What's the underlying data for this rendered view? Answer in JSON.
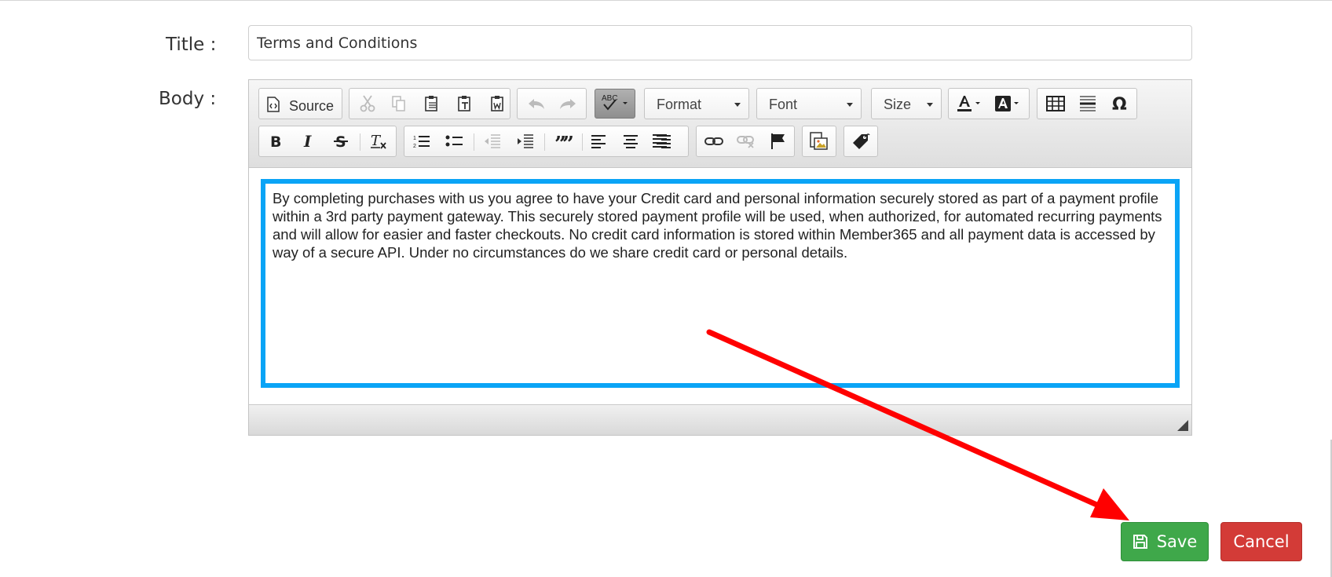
{
  "form": {
    "title_label": "Title :",
    "title_value": "Terms and Conditions",
    "body_label": "Body :"
  },
  "toolbar": {
    "source_label": "Source",
    "format_label": "Format",
    "font_label": "Font",
    "size_label": "Size"
  },
  "editor": {
    "content": "By completing purchases with us you agree to have your Credit card and personal information securely stored as part of a payment profile within a 3rd party payment gateway. This securely stored payment profile will be used, when authorized, for automated recurring payments and will allow for easier and faster checkouts. No credit card information is stored within Member365 and all payment data is accessed by way of a secure API. Under no circumstances do we share credit card or personal details."
  },
  "actions": {
    "save_label": "Save",
    "cancel_label": "Cancel"
  },
  "colors": {
    "highlight_border": "#0aa4f6",
    "annotation_arrow": "#ff0000",
    "save_button": "#3fa84a",
    "cancel_button": "#d33b37"
  },
  "icons": [
    "source-icon",
    "cut-icon",
    "copy-icon",
    "paste-icon",
    "paste-text-icon",
    "paste-word-icon",
    "undo-icon",
    "redo-icon",
    "spellcheck-icon",
    "text-color-icon",
    "background-color-icon",
    "table-icon",
    "horizontal-line-icon",
    "special-character-icon",
    "bold-icon",
    "italic-icon",
    "strikethrough-icon",
    "remove-format-icon",
    "numbered-list-icon",
    "bulleted-list-icon",
    "decrease-indent-icon",
    "increase-indent-icon",
    "blockquote-icon",
    "align-left-icon",
    "align-center-icon",
    "align-right-icon",
    "justify-icon",
    "link-icon",
    "unlink-icon",
    "anchor-icon",
    "image-icon",
    "placeholder-icon",
    "save-icon"
  ]
}
